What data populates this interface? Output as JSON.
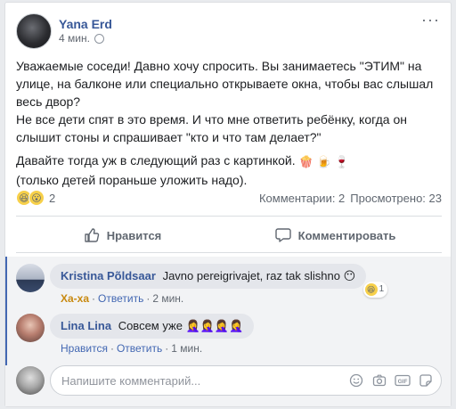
{
  "post": {
    "author": "Yana Erd",
    "time": "4 мин.",
    "paragraph1": "Уважаемые соседи! Давно хочу спросить. Вы занимаетесь \"ЭТИМ\" на улице, на балконе или специально открываете окна, чтобы вас слышал весь двор?",
    "paragraph2": "Не все дети спят в это время. И что мне ответить ребёнку, когда он слышит стоны и спрашивает \"кто и что там делает?\"",
    "paragraph3_line1": "Давайте тогда уж в следующий раз с картинкой.",
    "paragraph3_emojis": [
      "🍿",
      "🍺",
      "🍷"
    ],
    "paragraph3_line2": "(только детей пораньше уложить надо).",
    "reactions": {
      "icons": [
        "😆",
        "😮"
      ],
      "count": "2"
    },
    "comments_count": "Комментарии: 2",
    "views": "Просмотрено: 23"
  },
  "actions": {
    "like_label": "Нравится",
    "comment_label": "Комментировать"
  },
  "comments": [
    {
      "name": "Kristina Põldsaar",
      "text": "Javno pereigrivajet, raz tak slishno",
      "trail_emoji": "😶",
      "reaction_label": "Ха-ха",
      "reply_label": "Ответить",
      "time": "2 мин.",
      "reaction_icon": "😆",
      "reaction_count": "1"
    },
    {
      "name": "Lina Lina",
      "text": "Совсем уже",
      "trail_emoji": "🤦‍♀️🤦‍♀️🤦‍♀️🤦‍♀️",
      "like_label": "Нравится",
      "reply_label": "Ответить",
      "time": "1 мин."
    }
  ],
  "composer": {
    "placeholder": "Напишите комментарий...",
    "icons": [
      "emoji-icon",
      "camera-icon",
      "gif-icon",
      "sticker-icon"
    ]
  },
  "colors": {
    "link": "#385898",
    "accent": "#4267b2",
    "haha": "#c8890f"
  }
}
